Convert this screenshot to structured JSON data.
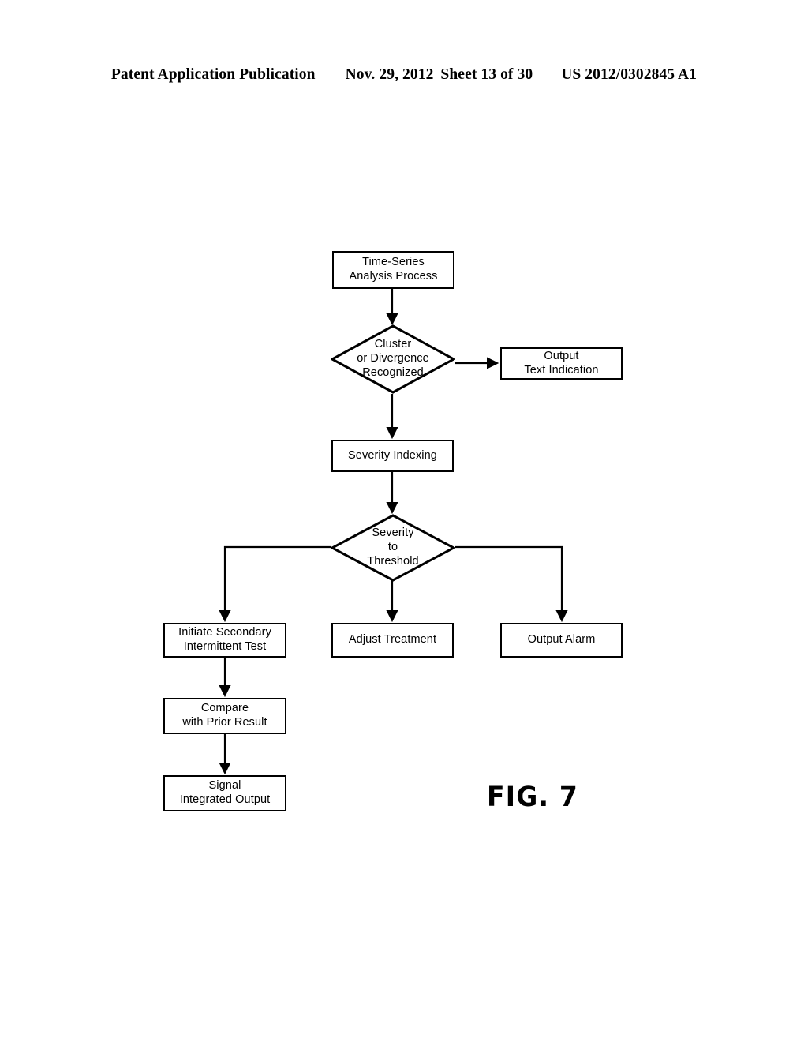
{
  "header": {
    "publication": "Patent Application Publication",
    "date": "Nov. 29, 2012",
    "sheet": "Sheet 13 of 30",
    "patent_number": "US 2012/0302845 A1"
  },
  "figure": {
    "caption": "FIG. 7"
  },
  "colors": {
    "ink": "#000000",
    "paper": "#ffffff"
  },
  "chart_data": {
    "type": "diagram",
    "title": "FIG. 7",
    "diagram_kind": "flowchart",
    "nodes": [
      {
        "id": "time-series-analysis-process",
        "shape": "process",
        "label": "Time-Series\nAnalysis Process"
      },
      {
        "id": "cluster-or-divergence-recognized",
        "shape": "decision",
        "label": "Cluster\nor Divergence\nRecognized"
      },
      {
        "id": "output-text-indication",
        "shape": "process",
        "label": "Output\nText Indication"
      },
      {
        "id": "severity-indexing",
        "shape": "process",
        "label": "Severity Indexing"
      },
      {
        "id": "severity-to-threshold",
        "shape": "decision",
        "label": "Severity\nto\nThreshold"
      },
      {
        "id": "initiate-secondary-intermittent-test",
        "shape": "process",
        "label": "Initiate Secondary\nIntermittent Test"
      },
      {
        "id": "adjust-treatment",
        "shape": "process",
        "label": "Adjust Treatment"
      },
      {
        "id": "output-alarm",
        "shape": "process",
        "label": "Output Alarm"
      },
      {
        "id": "compare-with-prior-result",
        "shape": "process",
        "label": "Compare\nwith Prior Result"
      },
      {
        "id": "signal-integrated-output",
        "shape": "process",
        "label": "Signal\nIntegrated Output"
      }
    ],
    "edges": [
      {
        "from": "time-series-analysis-process",
        "to": "cluster-or-divergence-recognized",
        "label": ""
      },
      {
        "from": "cluster-or-divergence-recognized",
        "to": "output-text-indication",
        "label": ""
      },
      {
        "from": "cluster-or-divergence-recognized",
        "to": "severity-indexing",
        "label": ""
      },
      {
        "from": "severity-indexing",
        "to": "severity-to-threshold",
        "label": ""
      },
      {
        "from": "severity-to-threshold",
        "to": "initiate-secondary-intermittent-test",
        "label": ""
      },
      {
        "from": "severity-to-threshold",
        "to": "adjust-treatment",
        "label": ""
      },
      {
        "from": "severity-to-threshold",
        "to": "output-alarm",
        "label": ""
      },
      {
        "from": "initiate-secondary-intermittent-test",
        "to": "compare-with-prior-result",
        "label": ""
      },
      {
        "from": "compare-with-prior-result",
        "to": "signal-integrated-output",
        "label": ""
      }
    ]
  },
  "nodes": {
    "time_series": "Time-Series\nAnalysis Process",
    "cluster_divergence": "Cluster\nor Divergence\nRecognized",
    "output_text": "Output\nText Indication",
    "severity_indexing": "Severity Indexing",
    "severity_threshold": "Severity\nto\nThreshold",
    "initiate_secondary": "Initiate Secondary\nIntermittent Test",
    "adjust_treatment": "Adjust Treatment",
    "output_alarm": "Output Alarm",
    "compare_prior": "Compare\nwith Prior Result",
    "signal_integrated": "Signal\nIntegrated Output"
  }
}
